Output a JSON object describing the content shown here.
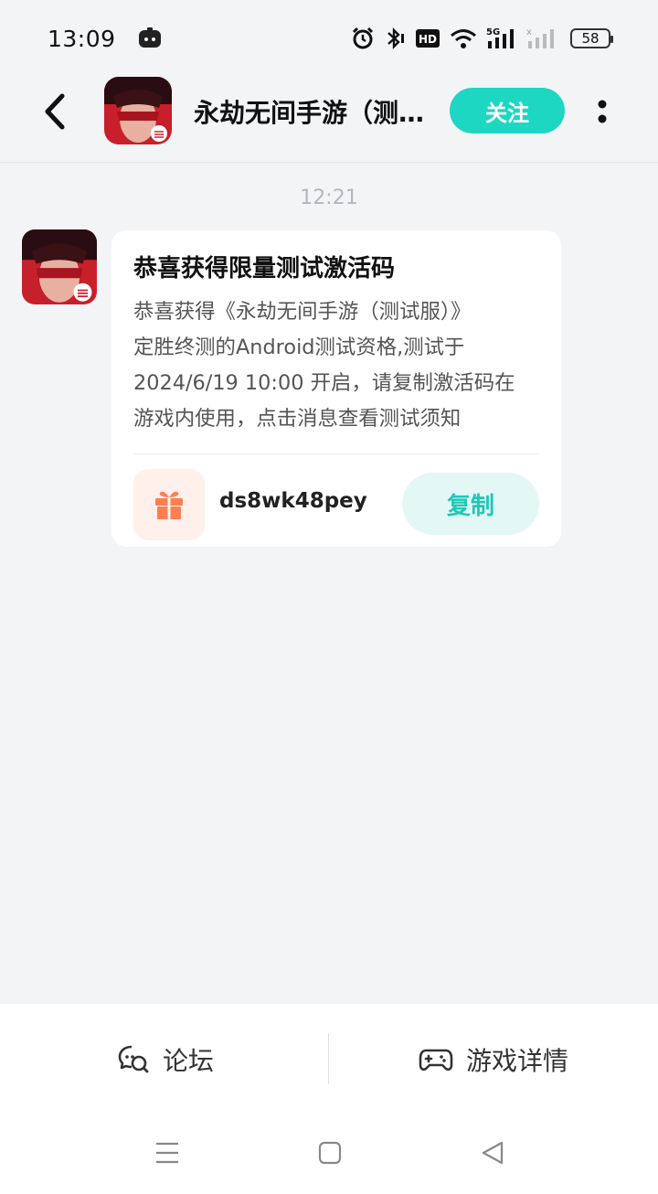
{
  "status_bar": {
    "time": "13:09",
    "battery": "58",
    "icons": [
      "app-notification-icon",
      "alarm-icon",
      "bluetooth-icon",
      "hd-icon",
      "wifi-icon",
      "signal-5g-icon",
      "signal-icon",
      "battery-icon"
    ]
  },
  "header": {
    "title": "永劫无间手游（测试服）",
    "follow_label": "关注"
  },
  "chat": {
    "timestamp": "12:21",
    "message": {
      "title": "恭喜获得限量测试激活码",
      "body_lines": [
        "恭喜获得《永劫无间手游（测试服）》",
        "定胜终测的Android测试资格,测试于",
        "2024/6/19 10:00 开启，请复制激活码在",
        "游戏内使用，点击消息查看测试须知"
      ],
      "code": "ds8wk48pey",
      "copy_label": "复制"
    }
  },
  "bottom_bar": {
    "forum_label": "论坛",
    "details_label": "游戏详情"
  },
  "colors": {
    "accent": "#1ed7c3",
    "copy_bg": "#e3f7f5",
    "copy_text": "#1ec9b6",
    "gift": "#ff7f50",
    "gift_bg": "#fff0ec"
  }
}
